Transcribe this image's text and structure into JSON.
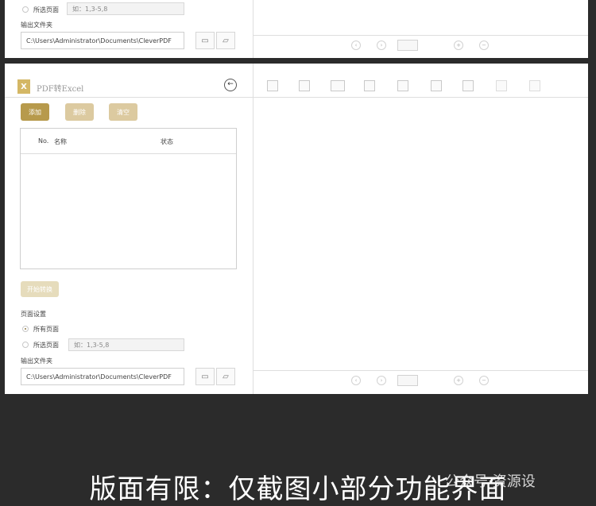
{
  "top_panel": {
    "selected_pages_label": "所选页面",
    "selected_pages_placeholder": "如：1,3-5,8",
    "output_folder_label": "输出文件夹",
    "output_folder_value": "C:\\Users\\Administrator\\Documents\\CleverPDF"
  },
  "main_panel": {
    "app_icon_text": "X",
    "title": "PDF转Excel",
    "buttons": {
      "add": "添加",
      "remove": "删除",
      "clear": "清空",
      "start": "开始转换"
    },
    "table": {
      "col_no": "No.",
      "col_name": "名称",
      "col_status": "状态"
    },
    "page_settings_label": "页面设置",
    "all_pages_label": "所有页面",
    "selected_pages_label": "所选页面",
    "selected_pages_placeholder": "如：1,3-5,8",
    "output_folder_label": "输出文件夹",
    "output_folder_value": "C:\\Users\\Administrator\\Documents\\CleverPDF"
  },
  "icons": {
    "folder": "folder-icon",
    "folder_open": "folder-open-icon",
    "back": "back-arrow-icon"
  },
  "colors": {
    "gold_strong": "#b79a4c",
    "gold_faded": "#dccaa0",
    "background": "#2b2b2b"
  },
  "caption": "版面有限：仅截图小部分功能界面",
  "watermark": "公众号·资源设"
}
